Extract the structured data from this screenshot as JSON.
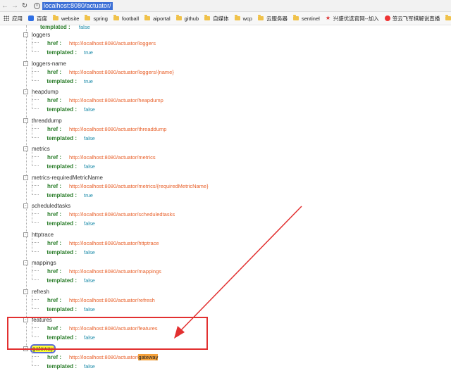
{
  "browser": {
    "url": "localhost:8080/actuator/"
  },
  "bookmarks": [
    {
      "label": "应用",
      "icon": "apps-icon"
    },
    {
      "label": "百度",
      "icon": "baidu-icon"
    },
    {
      "label": "website",
      "icon": "folder-icon"
    },
    {
      "label": "spring",
      "icon": "folder-icon"
    },
    {
      "label": "football",
      "icon": "folder-icon"
    },
    {
      "label": "aiportal",
      "icon": "folder-icon"
    },
    {
      "label": "github",
      "icon": "folder-icon"
    },
    {
      "label": "自媒体",
      "icon": "folder-icon"
    },
    {
      "label": "wcp",
      "icon": "folder-icon"
    },
    {
      "label": "云服务器",
      "icon": "folder-icon"
    },
    {
      "label": "sentinel",
      "icon": "folder-icon"
    },
    {
      "label": "兴盛优选官网--加入",
      "icon": "star-icon"
    },
    {
      "label": "笠云飞军棋解说直播",
      "icon": "xy-icon"
    },
    {
      "label": "木",
      "icon": "folder-icon"
    }
  ],
  "tree": {
    "top_partial": {
      "label": "templated :",
      "value": "false"
    },
    "entries": [
      {
        "key": "loggers",
        "href": "http://localhost:8080/actuator/loggers",
        "templated": "true"
      },
      {
        "key": "loggers-name",
        "href": "http://localhost:8080/actuator/loggers/{name}",
        "templated": "true"
      },
      {
        "key": "heapdump",
        "href": "http://localhost:8080/actuator/heapdump",
        "templated": "false"
      },
      {
        "key": "threaddump",
        "href": "http://localhost:8080/actuator/threaddump",
        "templated": "false"
      },
      {
        "key": "metrics",
        "href": "http://localhost:8080/actuator/metrics",
        "templated": "false"
      },
      {
        "key": "metrics-requiredMetricName",
        "href": "http://localhost:8080/actuator/metrics/{requiredMetricName}",
        "templated": "true"
      },
      {
        "key": "scheduledtasks",
        "href": "http://localhost:8080/actuator/scheduledtasks",
        "templated": "false"
      },
      {
        "key": "httptrace",
        "href": "http://localhost:8080/actuator/httptrace",
        "templated": "false"
      },
      {
        "key": "mappings",
        "href": "http://localhost:8080/actuator/mappings",
        "templated": "false"
      },
      {
        "key": "refresh",
        "href": "http://localhost:8080/actuator/refresh",
        "templated": "false"
      },
      {
        "key": "features",
        "href": "http://localhost:8080/actuator/features",
        "templated": "false"
      }
    ],
    "gateway": {
      "key": "gateway",
      "href_prefix": "http://localhost:8080/actuator/",
      "href_highlight": "gateway",
      "templated": "false"
    },
    "labels": {
      "href": "href :",
      "templated": "templated :"
    }
  },
  "colors": {
    "annotation": "#e23030",
    "key_highlight": "#ffff33",
    "value_highlight": "#f5a23c",
    "href": "#e8602a",
    "bool": "#1a8aa8",
    "label": "#2a7d2a"
  }
}
